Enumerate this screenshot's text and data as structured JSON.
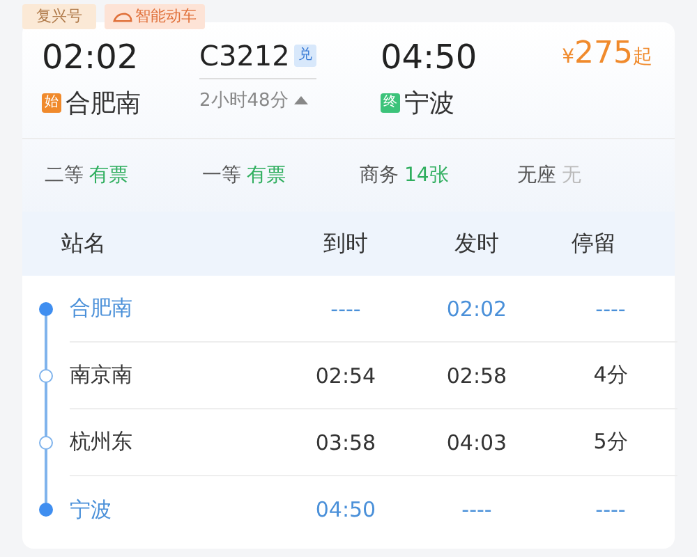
{
  "tags": [
    {
      "label": "复兴号",
      "kind": "plain"
    },
    {
      "label": "智能动车",
      "kind": "train"
    }
  ],
  "trip": {
    "depart_time": "02:02",
    "depart_badge": "始",
    "depart_station": "合肥南",
    "train_no": "C3212",
    "train_badge": "兑",
    "duration": "2小时48分",
    "expanded": true,
    "arrive_time": "04:50",
    "arrive_badge": "终",
    "arrive_station": "宁波",
    "price_symbol": "¥",
    "price": "275",
    "price_suffix": "起"
  },
  "seats": [
    {
      "class": "二等",
      "availability": "有票",
      "available": true
    },
    {
      "class": "一等",
      "availability": "有票",
      "available": true
    },
    {
      "class": "商务",
      "availability": "14张",
      "available": true
    },
    {
      "class": "无座",
      "availability": "无",
      "available": false
    }
  ],
  "table": {
    "columns": [
      "站名",
      "到时",
      "发时",
      "停留"
    ],
    "rows": [
      {
        "kind": "endpoint",
        "station": "合肥南",
        "arrive": "----",
        "depart": "02:02",
        "stop": "----"
      },
      {
        "kind": "stop",
        "station": "南京南",
        "arrive": "02:54",
        "depart": "02:58",
        "stop": "4分"
      },
      {
        "kind": "stop",
        "station": "杭州东",
        "arrive": "03:58",
        "depart": "04:03",
        "stop": "5分"
      },
      {
        "kind": "endpoint",
        "station": "宁波",
        "arrive": "04:50",
        "depart": "----",
        "stop": "----"
      }
    ]
  }
}
